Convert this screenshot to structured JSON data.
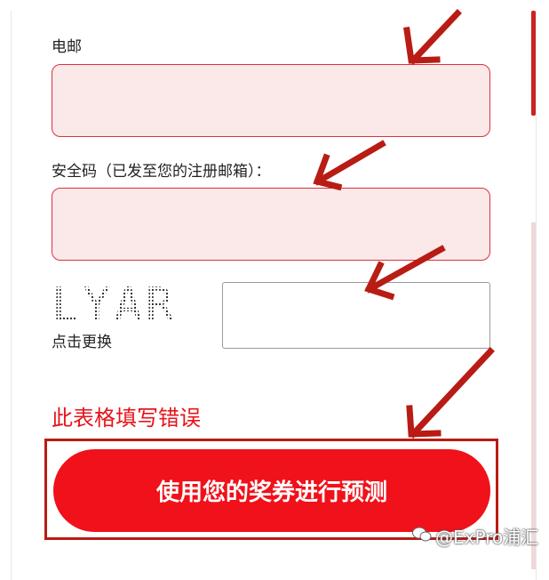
{
  "form": {
    "email_label": "电邮",
    "email_value": "",
    "security_label": "安全码（已发至您的注册邮箱）：",
    "security_value": "",
    "captcha_text": "LYAR",
    "captcha_refresh_label": "点击更换",
    "captcha_value": "",
    "error_text": "此表格填写错误",
    "submit_label": "使用您的奖券进行预测"
  },
  "watermark": {
    "text": "@ExPro浦汇",
    "icon": "wechat-icon"
  },
  "colors": {
    "accent": "#f0111a",
    "error": "#e6141b",
    "field_bg": "#fbe8e9",
    "field_border": "#d9333f",
    "arrow": "#b81c14"
  }
}
